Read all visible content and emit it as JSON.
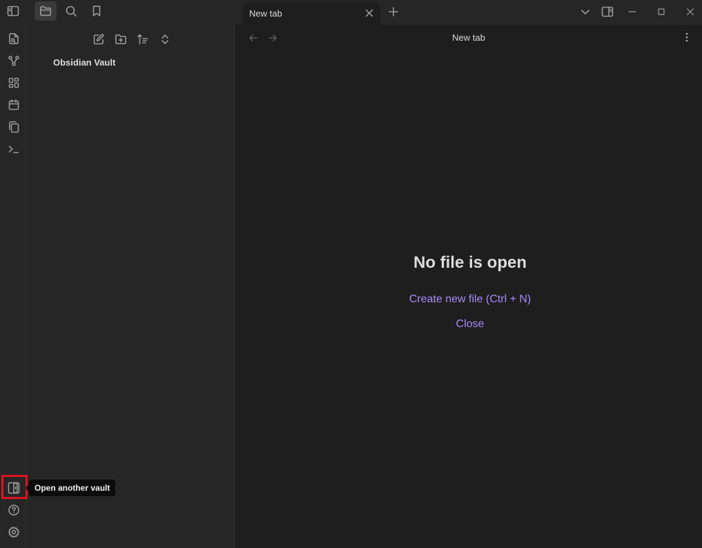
{
  "tab": {
    "title": "New tab"
  },
  "explorer": {
    "vault_name": "Obsidian Vault"
  },
  "main": {
    "view_title": "New tab",
    "empty_state": {
      "title": "No file is open",
      "create_label": "Create new file (Ctrl + N)",
      "close_label": "Close"
    }
  },
  "tooltip": {
    "text": "Open another vault"
  },
  "colors": {
    "accent": "#a88bfa",
    "highlight": "#e0141e",
    "background": "#1e1e1e",
    "sidebar": "#262626"
  },
  "icons": {
    "topbar": [
      "sidebar-toggle-icon",
      "folder-icon",
      "search-icon",
      "bookmark-icon"
    ],
    "ribbon": [
      "open-quick-switcher-icon",
      "graph-view-icon",
      "canvas-icon",
      "calendar-icon",
      "templates-icon",
      "command-palette-icon",
      "vault-icon",
      "help-icon",
      "settings-icon"
    ],
    "explorer_toolbar": [
      "new-note-icon",
      "new-folder-icon",
      "sort-icon",
      "collapse-expand-icon"
    ],
    "window": [
      "tab-list-icon",
      "right-sidebar-toggle-icon",
      "minimize-icon",
      "maximize-icon",
      "close-window-icon"
    ]
  }
}
